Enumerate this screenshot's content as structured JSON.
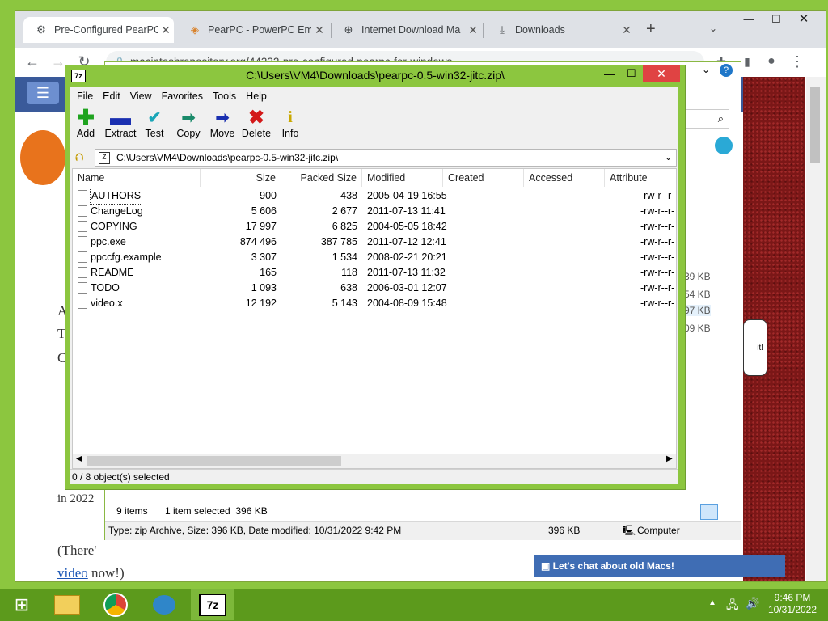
{
  "browser": {
    "tabs": [
      {
        "title": "Pre-Configured PearPC",
        "icon": "mac-repository-icon"
      },
      {
        "title": "PearPC - PowerPC Emul",
        "icon": "pearpc-icon"
      },
      {
        "title": "Internet Download Ma",
        "icon": "globe-icon"
      },
      {
        "title": "Downloads",
        "icon": "download-icon"
      }
    ],
    "url": "macintoshrepository.org/44332-pre-configured-pearpc-for-windows"
  },
  "page": {
    "year_text": "in 2022",
    "there_text": "(There'",
    "video_link": "video",
    "video_after": " now!)",
    "chat_banner": "Let's chat about old Macs!",
    "bubble_text": "it!",
    "sizes": [
      "39 KB",
      "54 KB",
      "97 KB",
      "09 KB"
    ],
    "side_letters": [
      "A",
      "T",
      "C"
    ]
  },
  "explorer": {
    "items_count": "9 items",
    "selected": "1 item selected  396 KB",
    "details": "Type: zip Archive, Size: 396 KB, Date modified: 10/31/2022 9:42 PM",
    "size": "396 KB",
    "location": "Computer"
  },
  "sevenzip": {
    "title": "C:\\Users\\VM4\\Downloads\\pearpc-0.5-win32-jitc.zip\\",
    "menu": [
      "File",
      "Edit",
      "View",
      "Favorites",
      "Tools",
      "Help"
    ],
    "toolbar": [
      "Add",
      "Extract",
      "Test",
      "Copy",
      "Move",
      "Delete",
      "Info"
    ],
    "address": "C:\\Users\\VM4\\Downloads\\pearpc-0.5-win32-jitc.zip\\",
    "columns": [
      "Name",
      "Size",
      "Packed Size",
      "Modified",
      "Created",
      "Accessed",
      "Attribute"
    ],
    "files": [
      {
        "name": "AUTHORS",
        "size": "900",
        "packed": "438",
        "modified": "2005-04-19 16:55",
        "attr": "-rw-r--r-"
      },
      {
        "name": "ChangeLog",
        "size": "5 606",
        "packed": "2 677",
        "modified": "2011-07-13 11:41",
        "attr": "-rw-r--r-"
      },
      {
        "name": "COPYING",
        "size": "17 997",
        "packed": "6 825",
        "modified": "2004-05-05 18:42",
        "attr": "-rw-r--r-"
      },
      {
        "name": "ppc.exe",
        "size": "874 496",
        "packed": "387 785",
        "modified": "2011-07-12 12:41",
        "attr": "-rw-r--r-"
      },
      {
        "name": "ppccfg.example",
        "size": "3 307",
        "packed": "1 534",
        "modified": "2008-02-21 20:21",
        "attr": "-rw-r--r-"
      },
      {
        "name": "README",
        "size": "165",
        "packed": "118",
        "modified": "2011-07-13 11:32",
        "attr": "-rw-r--r-"
      },
      {
        "name": "TODO",
        "size": "1 093",
        "packed": "638",
        "modified": "2006-03-01 12:07",
        "attr": "-rw-r--r-"
      },
      {
        "name": "video.x",
        "size": "12 192",
        "packed": "5 143",
        "modified": "2004-08-09 15:48",
        "attr": "-rw-r--r-"
      }
    ],
    "status": "0 / 8 object(s) selected"
  },
  "taskbar": {
    "time": "9:46 PM",
    "date": "10/31/2022",
    "active_app": "7-zip"
  },
  "colors": {
    "desktop": "#8cc63f",
    "taskbar": "#5c9a1c"
  }
}
